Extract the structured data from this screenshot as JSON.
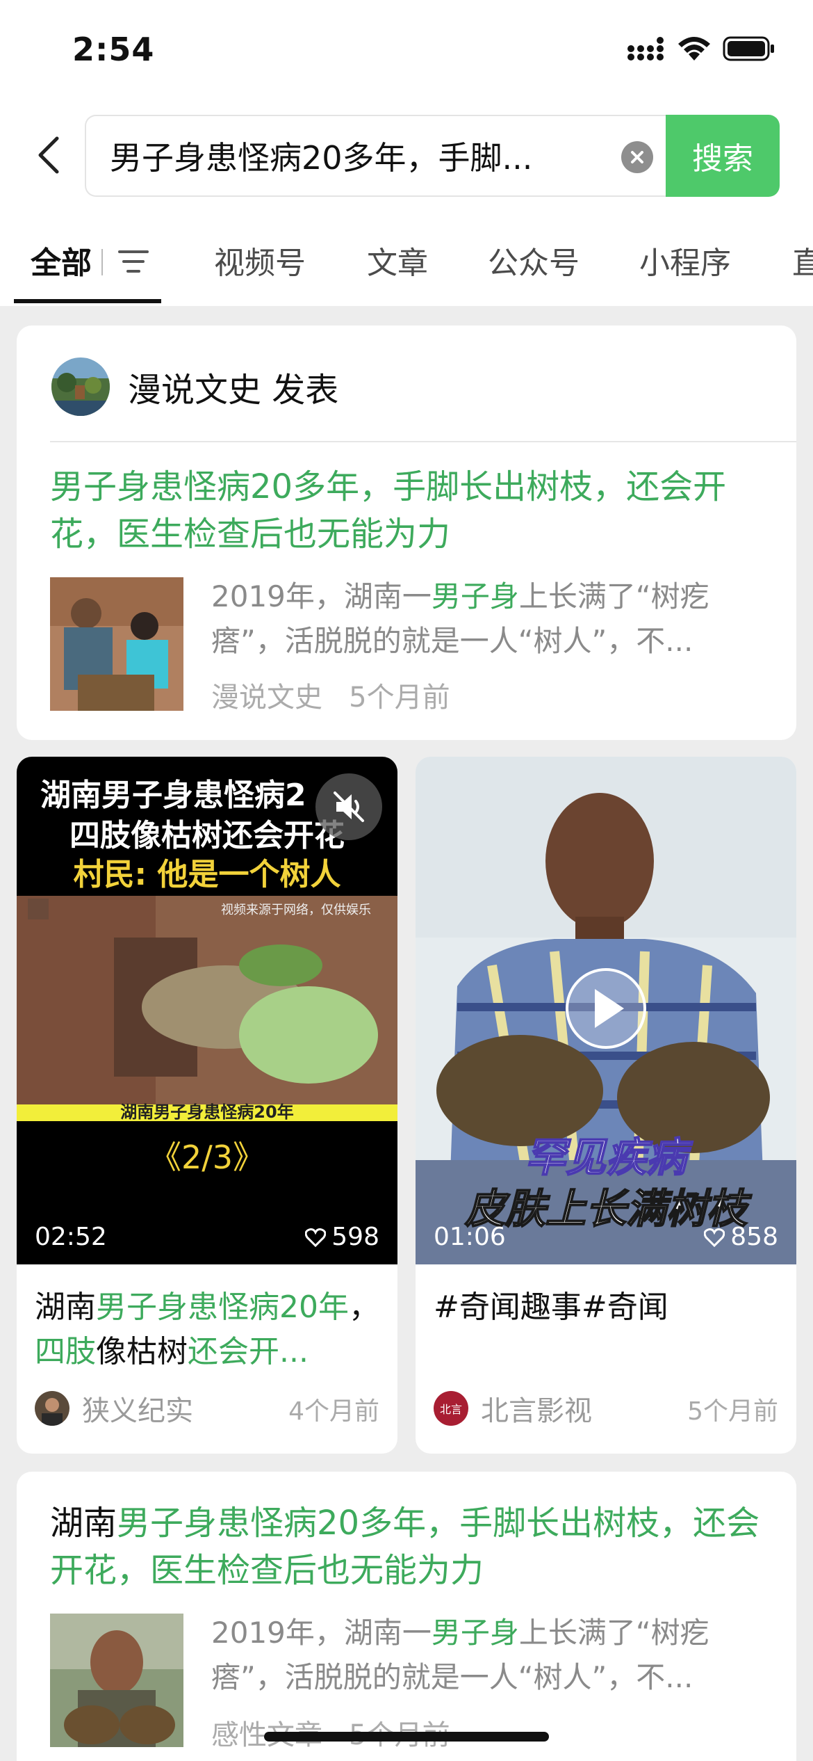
{
  "status_bar": {
    "time": "2:54"
  },
  "search": {
    "query": "男子身患怪病20多年，手脚...",
    "button_label": "搜索"
  },
  "tabs": [
    "全部",
    "视频号",
    "文章",
    "公众号",
    "小程序",
    "直"
  ],
  "article_1": {
    "author_line": "漫说文史 发表",
    "title": "男子身患怪病20多年，手脚长出树枝，还会开花，医生检查后也无能为力",
    "snippet_1": "2019年，湖南一",
    "snippet_hl": "男子身",
    "snippet_2": "上长满了“树疙瘩”，活脱脱的就是一人“树人”，不...",
    "source": "漫说文史",
    "time": "5个月前"
  },
  "video_1": {
    "overlay_line1": "湖南男子身患怪病2",
    "overlay_line2": "四肢像枯树还会开花",
    "overlay_line3": "村民: 他是一个树人",
    "watermark": "视频来源于网络，仅供娱乐",
    "subtitle": "湖南男子身患怪病20年",
    "part": "《2/3》",
    "duration": "02:52",
    "likes": "598",
    "caption_1": "湖南",
    "caption_hl1": "男子身患怪病20年",
    "caption_2": "，",
    "caption_hl2": "四肢",
    "caption_3": "像枯树",
    "caption_hl3": "还会开...",
    "author": "狭义纪实",
    "time": "4个月前"
  },
  "video_2": {
    "overlay_line1": "罕见疾病",
    "overlay_line2": "皮肤上长满树枝",
    "duration": "01:06",
    "likes": "858",
    "caption": "#奇闻趣事#奇闻",
    "author_avatar_text": "北言",
    "author": "北言影视",
    "time": "5个月前"
  },
  "article_2": {
    "title_black": "湖南",
    "title_green": "男子身患怪病20多年，手脚长出树枝，还会开花，医生检查后也无能为力",
    "snippet_1": "2019年，湖南一",
    "snippet_hl": "男子身",
    "snippet_2": "上长满了“树疙瘩”，活脱脱的就是一人“树人”，不...",
    "source": "感性文章",
    "time": "5个月前"
  }
}
